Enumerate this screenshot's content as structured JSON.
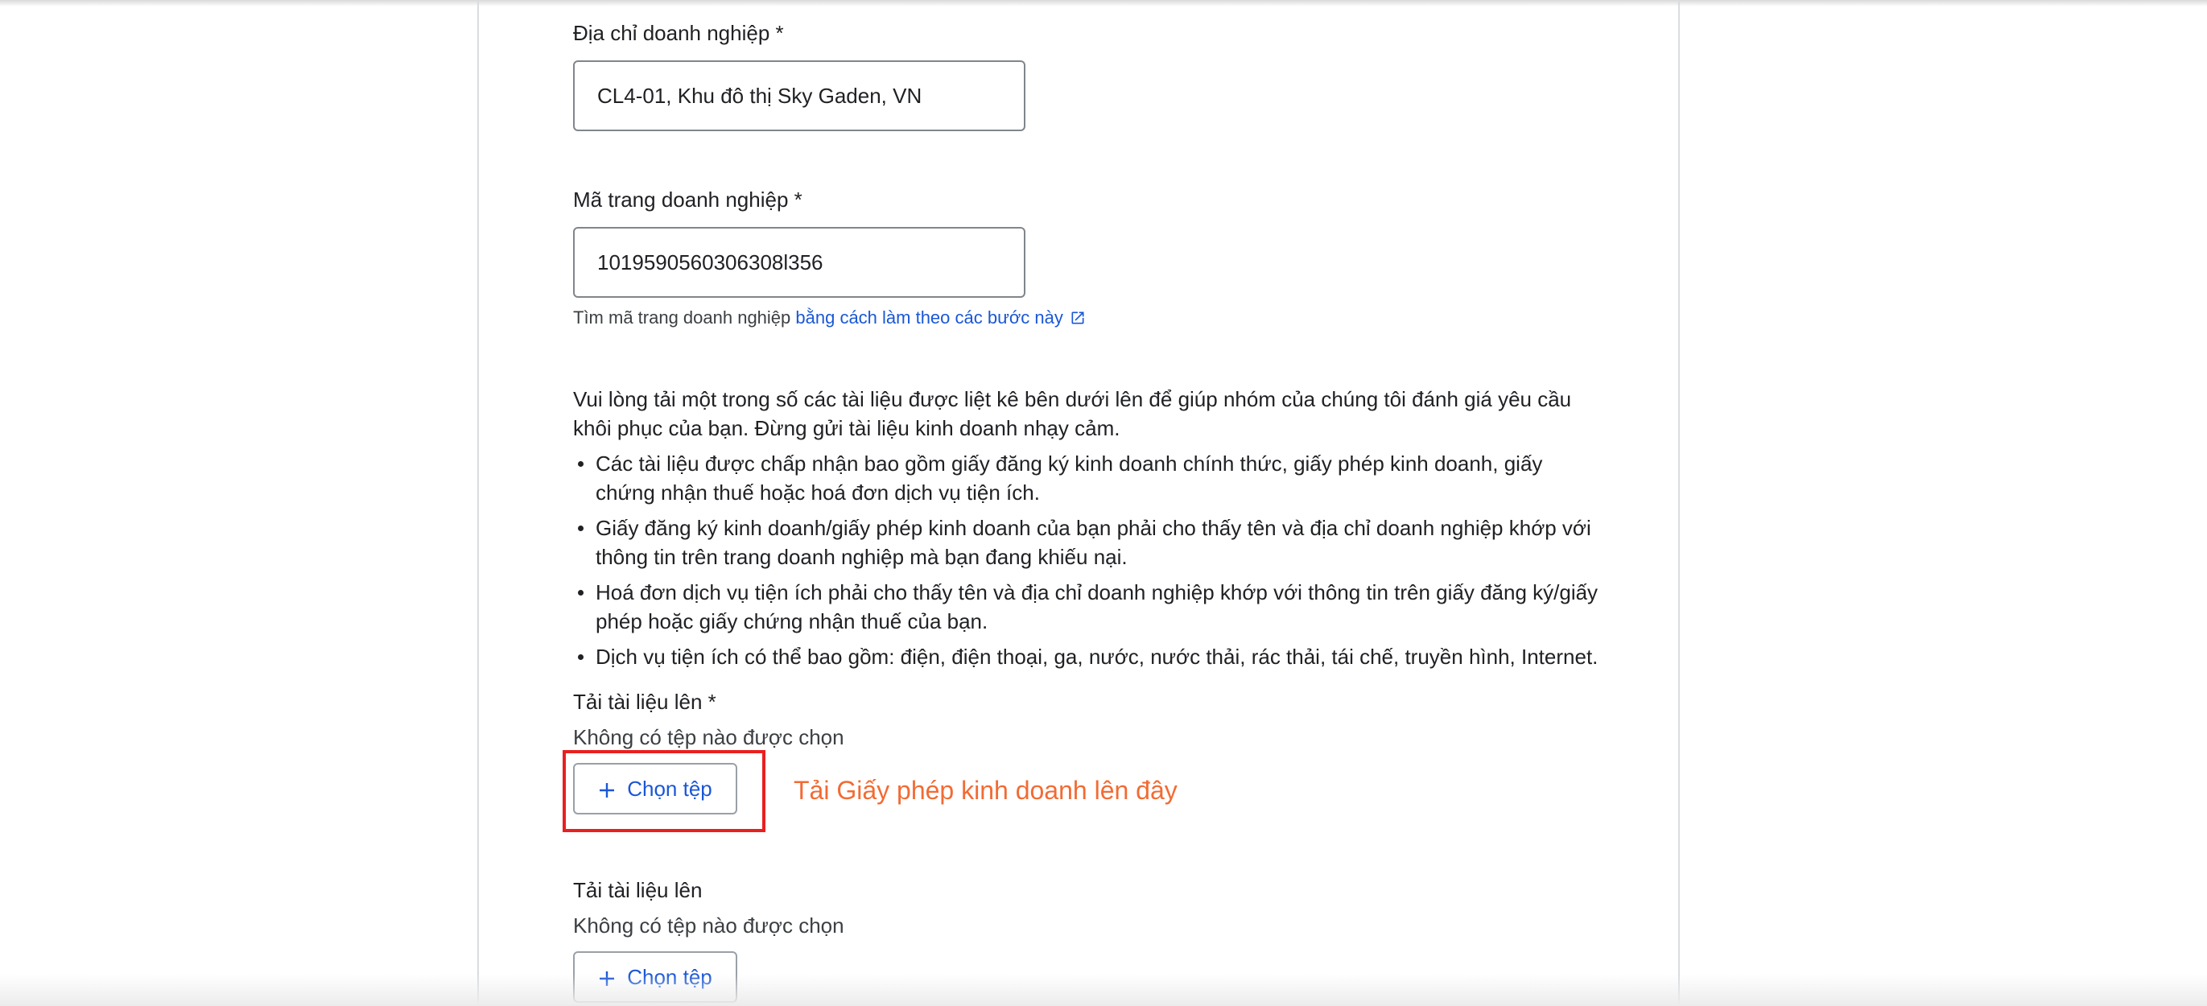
{
  "address": {
    "label": "Địa chỉ doanh nghiệp *",
    "value": "CL4-01, Khu đô thị Sky Gaden, VN"
  },
  "page_id": {
    "label": "Mã trang doanh nghiệp *",
    "value": "1019590560306308l356",
    "helper_text": "Tìm mã trang doanh nghiệp ",
    "helper_link": "bằng cách làm theo các bước này"
  },
  "instructions": {
    "intro": "Vui lòng tải một trong số các tài liệu được liệt kê bên dưới lên để giúp nhóm của chúng tôi đánh giá yêu cầu khôi phục của bạn. Đừng gửi tài liệu kinh doanh nhạy cảm.",
    "bullets": [
      "Các tài liệu được chấp nhận bao gồm giấy đăng ký kinh doanh chính thức, giấy phép kinh doanh, giấy chứng nhận thuế hoặc hoá đơn dịch vụ tiện ích.",
      "Giấy đăng ký kinh doanh/giấy phép kinh doanh của bạn phải cho thấy tên và địa chỉ doanh nghiệp khớp với thông tin trên trang doanh nghiệp mà bạn đang khiếu nại.",
      "Hoá đơn dịch vụ tiện ích phải cho thấy tên và địa chỉ doanh nghiệp khớp với thông tin trên giấy đăng ký/giấy phép hoặc giấy chứng nhận thuế của bạn.",
      "Dịch vụ tiện ích có thể bao gồm: điện, điện thoại, ga, nước, nước thải, rác thải, tái chế, truyền hình, Internet."
    ]
  },
  "upload_1": {
    "label": "Tải tài liệu lên *",
    "status": "Không có tệp nào được chọn",
    "button": "Chọn tệp"
  },
  "annotation": {
    "text": "Tải Giấy phép kinh doanh lên đây",
    "color": "#f26b34",
    "box_color": "#e8201f"
  },
  "upload_2": {
    "label": "Tải tài liệu lên",
    "status": "Không có tệp nào được chọn",
    "button": "Chọn tệp"
  },
  "colors": {
    "link": "#1a57d6",
    "text": "#202124"
  },
  "icons": [
    "external-link-icon",
    "plus-icon"
  ]
}
